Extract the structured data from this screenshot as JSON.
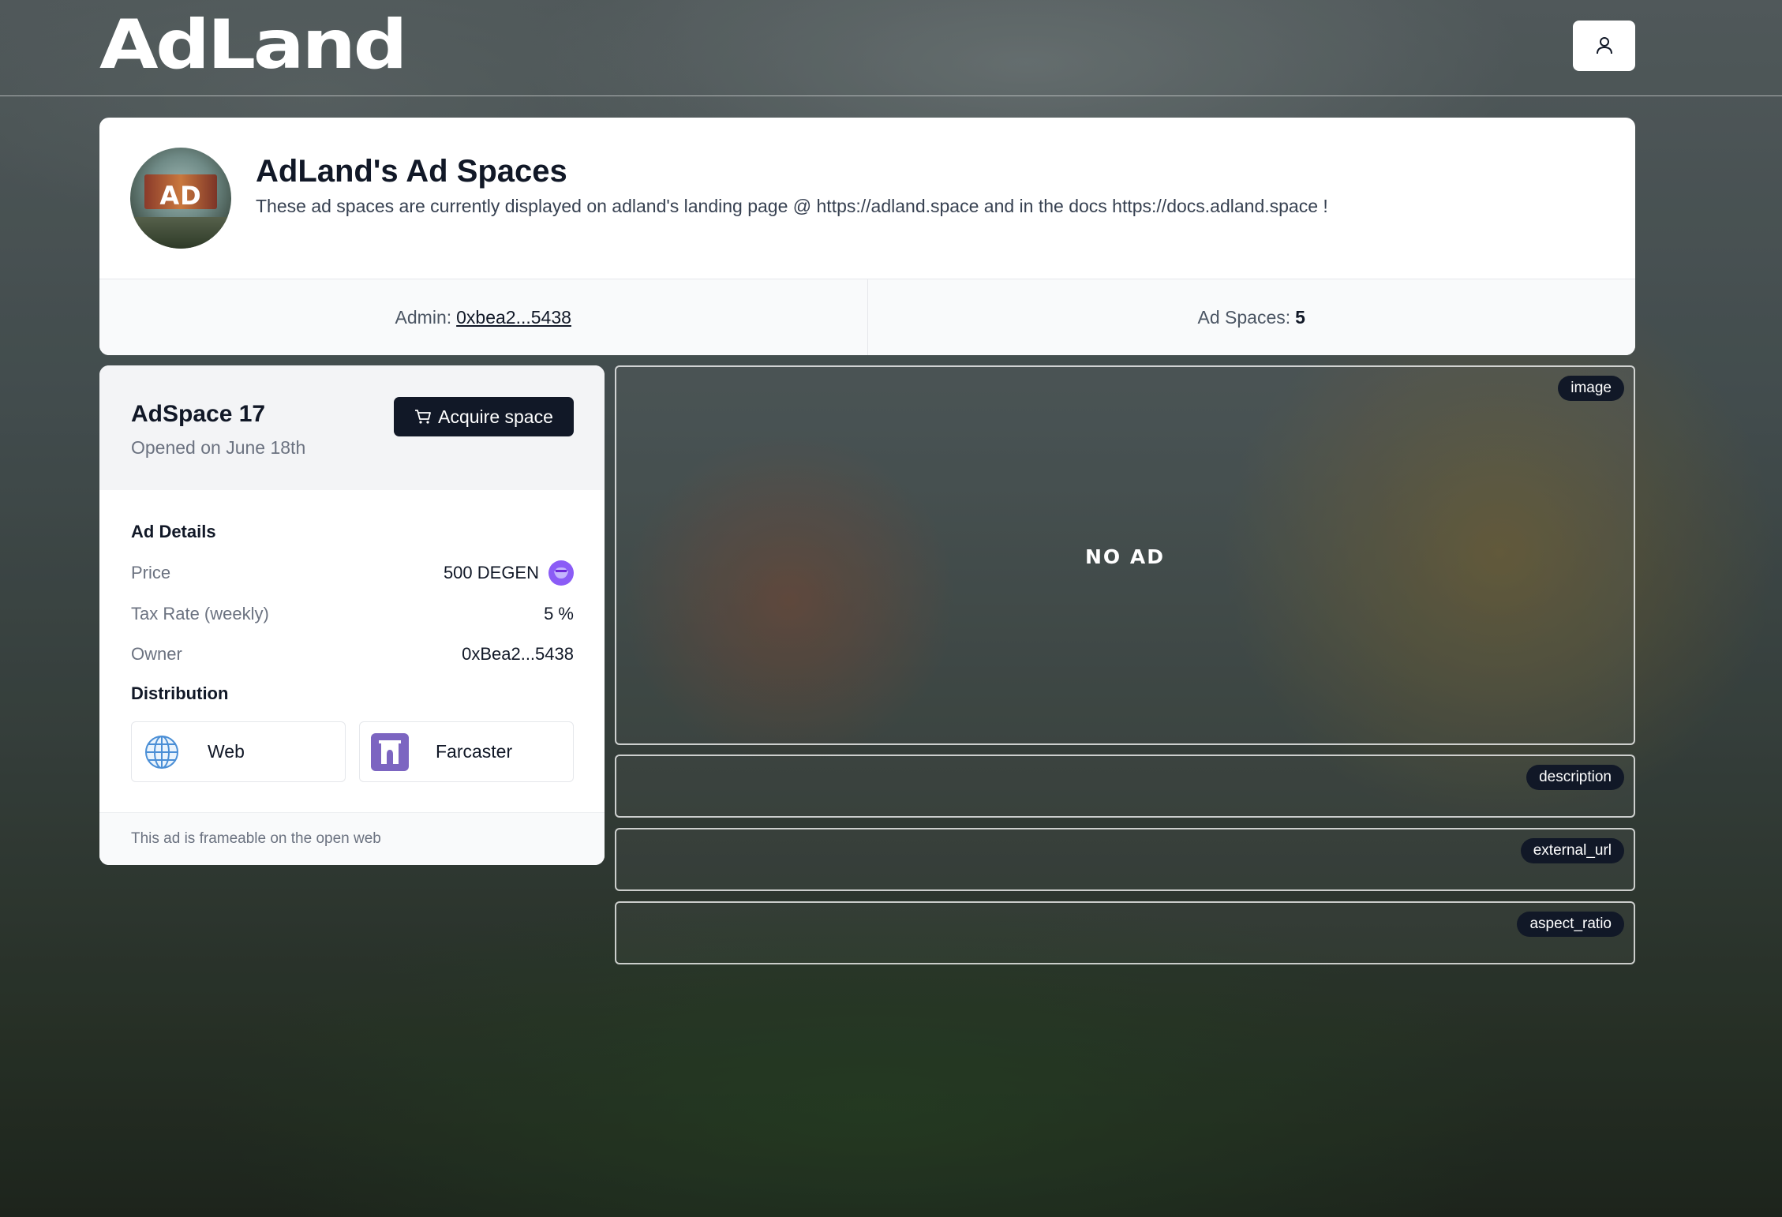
{
  "header": {
    "logo": "AdLand",
    "user_icon": "user-icon"
  },
  "info": {
    "avatar_text": "AD",
    "title": "AdLand's Ad Spaces",
    "description": "These ad spaces are currently displayed on adland's landing page @ https://adland.space and in the docs https://docs.adland.space !",
    "admin_label": "Admin:",
    "admin_address": "0xbea2...5438",
    "ad_spaces_label": "Ad Spaces:",
    "ad_spaces_count": "5"
  },
  "ad_space": {
    "name": "AdSpace 17",
    "opened": "Opened on June 18th",
    "acquire_label": "Acquire space",
    "details_heading": "Ad Details",
    "price_label": "Price",
    "price_value": "500 DEGEN",
    "tax_label": "Tax Rate (weekly)",
    "tax_value": "5 %",
    "owner_label": "Owner",
    "owner_value": "0xBea2...5438",
    "distribution_heading": "Distribution",
    "distribution": [
      {
        "label": "Web",
        "icon": "globe-icon"
      },
      {
        "label": "Farcaster",
        "icon": "farcaster-icon"
      }
    ],
    "footer_note": "This ad is frameable on the open web"
  },
  "preview": {
    "no_ad": "NO AD",
    "tags": {
      "image": "image",
      "description": "description",
      "external_url": "external_url",
      "aspect_ratio": "aspect_ratio"
    }
  },
  "colors": {
    "dark_button": "#111827",
    "degen_purple": "#8b5cf6",
    "farcaster_purple": "#7c65c1"
  }
}
